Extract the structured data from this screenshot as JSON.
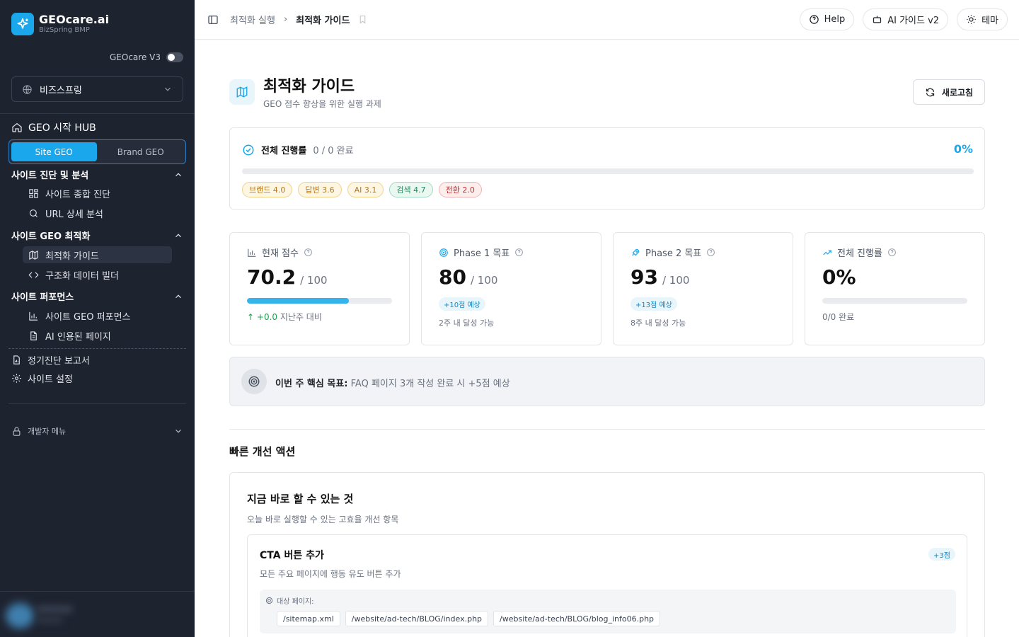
{
  "brand": {
    "title": "GEOcare.ai",
    "subtitle": "BizSpring BMP"
  },
  "version_toggle": {
    "label": "GEOcare V3",
    "on": false
  },
  "org_select": {
    "value": "비즈스프링"
  },
  "sidebar": {
    "hub": "GEO 시작 HUB",
    "segment": [
      "Site GEO",
      "Brand GEO"
    ],
    "sections": [
      {
        "title": "사이트 진단 및 분석",
        "items": [
          {
            "label": "사이트 종합 진단",
            "icon": "grid-icon"
          },
          {
            "label": "URL 상세 분석",
            "icon": "search-icon"
          }
        ]
      },
      {
        "title": "사이트 GEO 최적화",
        "items": [
          {
            "label": "최적화 가이드",
            "icon": "map-icon"
          },
          {
            "label": "구조화 데이터 빌더",
            "icon": "code-icon"
          }
        ]
      },
      {
        "title": "사이트 퍼포먼스",
        "items": [
          {
            "label": "사이트 GEO 퍼포먼스",
            "icon": "bar-chart-icon"
          },
          {
            "label": "AI 인용된 페이지",
            "icon": "file-icon"
          }
        ]
      }
    ],
    "extra": [
      "정기진단 보고서",
      "사이트 설정"
    ],
    "dev_menu": "개발자 메뉴"
  },
  "topbar": {
    "breadcrumb": [
      "최적화 실행",
      "최적화 가이드"
    ],
    "buttons": [
      "Help",
      "AI 가이드 v2",
      "테마"
    ]
  },
  "page": {
    "title": "최적화 가이드",
    "subtitle": "GEO 점수 향상을 위한 실행 과제",
    "refresh": "새로고침"
  },
  "overall": {
    "label": "전체 진행률",
    "count": "0 / 0 완료",
    "percent": "0%",
    "progress": 0,
    "tags": [
      {
        "text": "브랜드 4.0",
        "color": "#b7791f",
        "bg": "#fdf6e3",
        "border": "#f0d28a"
      },
      {
        "text": "답변 3.6",
        "color": "#b7791f",
        "bg": "#fdf6e3",
        "border": "#f0d28a"
      },
      {
        "text": "AI 3.1",
        "color": "#b7791f",
        "bg": "#fdf6e3",
        "border": "#f0d28a"
      },
      {
        "text": "검색 4.7",
        "color": "#1f8a5c",
        "bg": "#eaf8f1",
        "border": "#9fdcbf"
      },
      {
        "text": "전환 2.0",
        "color": "#c53030",
        "bg": "#fdeeee",
        "border": "#f2b2b2"
      }
    ]
  },
  "stats": [
    {
      "label": "현재 점수",
      "value": "70.2",
      "unit": "/ 100",
      "progress": 0.702,
      "note": "+0.0",
      "note_suffix": "지난주 대비"
    },
    {
      "label": "Phase 1 목표",
      "value": "80",
      "unit": "/ 100",
      "chip": "+10점 예상",
      "note": "2주 내 달성 가능"
    },
    {
      "label": "Phase 2 목표",
      "value": "93",
      "unit": "/ 100",
      "chip": "+13점 예상",
      "note": "8주 내 달성 가능"
    },
    {
      "label": "전체 진행률",
      "value": "0%",
      "progress": 0,
      "note": "0/0 완료"
    }
  ],
  "weekly_goal": {
    "label": "이번 주 핵심 목표:",
    "text": "FAQ 페이지 3개 작성 완료 시 +5점 예상"
  },
  "quick": {
    "title": "빠른 개선 액션",
    "card_title": "지금 바로 할 수 있는 것",
    "card_sub": "오늘 바로 실행할 수 있는 고효율 개선 항목",
    "item": {
      "title": "CTA 버튼 추가",
      "points": "+3점",
      "desc": "모든 주요 페이지에 행동 유도 버튼 추가",
      "target_label": "대상 페이지:",
      "paths": [
        "/sitemap.xml",
        "/website/ad-tech/BLOG/index.php",
        "/website/ad-tech/BLOG/blog_info06.php"
      ]
    }
  },
  "colors": {
    "accent": "#1aa7ec",
    "sidebar": "#1e2330"
  }
}
